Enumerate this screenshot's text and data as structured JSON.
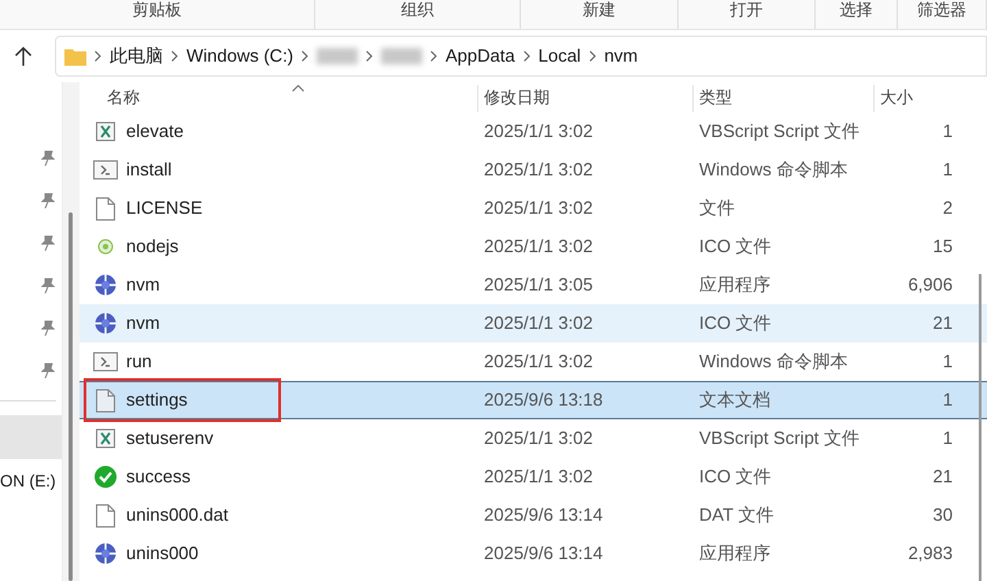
{
  "ribbon_groups": [
    "剪贴板",
    "组织",
    "新建",
    "打开",
    "选择",
    "筛选器"
  ],
  "breadcrumbs": [
    {
      "kind": "text",
      "label": "此电脑"
    },
    {
      "kind": "text",
      "label": "Windows (C:)"
    },
    {
      "kind": "redacted"
    },
    {
      "kind": "redacted"
    },
    {
      "kind": "text",
      "label": "AppData"
    },
    {
      "kind": "text",
      "label": "Local"
    },
    {
      "kind": "text",
      "label": "nvm"
    }
  ],
  "nav_items": [
    {
      "selected": true
    },
    {
      "label": "ON (E:)",
      "selected": false
    }
  ],
  "columns": [
    "名称",
    "修改日期",
    "类型",
    "大小"
  ],
  "rows": [
    {
      "kind": "script",
      "name": "elevate",
      "date": "2025/1/1 3:02",
      "type": "VBScript Script 文件",
      "size": "1",
      "selected": false,
      "hovered": false,
      "annotated": false
    },
    {
      "kind": "cmd",
      "name": "install",
      "date": "2025/1/1 3:02",
      "type": "Windows 命令脚本",
      "size": "1",
      "selected": false,
      "hovered": false,
      "annotated": false
    },
    {
      "kind": "file",
      "name": "LICENSE",
      "date": "2025/1/1 3:02",
      "type": "文件",
      "size": "2",
      "selected": false,
      "hovered": false,
      "annotated": false
    },
    {
      "kind": "node",
      "name": "nodejs",
      "date": "2025/1/1 3:02",
      "type": "ICO 文件",
      "size": "15",
      "selected": false,
      "hovered": false,
      "annotated": false
    },
    {
      "kind": "app",
      "name": "nvm",
      "date": "2025/1/1 3:05",
      "type": "应用程序",
      "size": "6,906",
      "selected": false,
      "hovered": false,
      "annotated": false
    },
    {
      "kind": "app",
      "name": "nvm",
      "date": "2025/1/1 3:02",
      "type": "ICO 文件",
      "size": "21",
      "selected": false,
      "hovered": true,
      "annotated": false
    },
    {
      "kind": "cmd",
      "name": "run",
      "date": "2025/1/1 3:02",
      "type": "Windows 命令脚本",
      "size": "1",
      "selected": false,
      "hovered": false,
      "annotated": false
    },
    {
      "kind": "text",
      "name": "settings",
      "date": "2025/9/6 13:18",
      "type": "文本文档",
      "size": "1",
      "selected": true,
      "hovered": false,
      "annotated": true
    },
    {
      "kind": "script",
      "name": "setuserenv",
      "date": "2025/1/1 3:02",
      "type": "VBScript Script 文件",
      "size": "1",
      "selected": false,
      "hovered": false,
      "annotated": false
    },
    {
      "kind": "success",
      "name": "success",
      "date": "2025/1/1 3:02",
      "type": "ICO 文件",
      "size": "21",
      "selected": false,
      "hovered": false,
      "annotated": false
    },
    {
      "kind": "file",
      "name": "unins000.dat",
      "date": "2025/9/6 13:14",
      "type": "DAT 文件",
      "size": "30",
      "selected": false,
      "hovered": false,
      "annotated": false
    },
    {
      "kind": "app",
      "name": "unins000",
      "date": "2025/9/6 13:14",
      "type": "应用程序",
      "size": "2,983",
      "selected": false,
      "hovered": false,
      "annotated": false
    }
  ]
}
